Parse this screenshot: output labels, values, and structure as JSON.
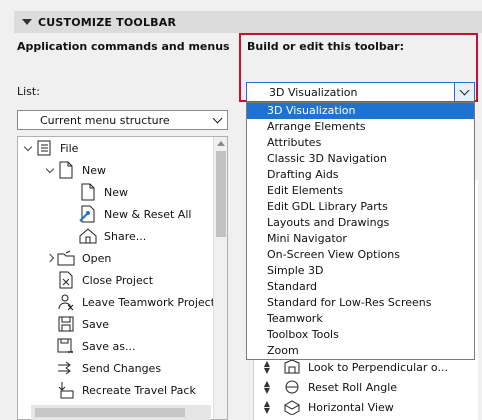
{
  "section": {
    "title": "CUSTOMIZE TOOLBAR"
  },
  "left": {
    "heading": "Application commands and menus",
    "list_label": "List:",
    "list_select": "Current menu structure",
    "tree": [
      {
        "label": "File",
        "indent": 0,
        "chevron": "down",
        "icon": "menu-list-icon"
      },
      {
        "label": "New",
        "indent": 1,
        "chevron": "down",
        "icon": "document-icon"
      },
      {
        "label": "New",
        "indent": 2,
        "chevron": "",
        "icon": "document-icon"
      },
      {
        "label": "New & Reset All",
        "indent": 2,
        "chevron": "",
        "icon": "new-reset-icon"
      },
      {
        "label": "Share...",
        "indent": 2,
        "chevron": "",
        "icon": "share-icon"
      },
      {
        "label": "Open",
        "indent": 1,
        "chevron": "right",
        "icon": "open-folder-icon"
      },
      {
        "label": "Close Project",
        "indent": 1,
        "chevron": "",
        "icon": "close-project-icon"
      },
      {
        "label": "Leave Teamwork Project",
        "indent": 1,
        "chevron": "",
        "icon": "leave-teamwork-icon"
      },
      {
        "label": "Save",
        "indent": 1,
        "chevron": "",
        "icon": "save-icon"
      },
      {
        "label": "Save as...",
        "indent": 1,
        "chevron": "",
        "icon": "save-as-icon"
      },
      {
        "label": "Send Changes",
        "indent": 1,
        "chevron": "",
        "icon": "send-changes-icon"
      },
      {
        "label": "Recreate Travel Pack",
        "indent": 1,
        "chevron": "",
        "icon": "travel-pack-icon"
      }
    ]
  },
  "right": {
    "heading": "Build or edit this toolbar:",
    "toolbar_select": "3D Visualization",
    "dropdown_options": [
      "3D Visualization",
      "Arrange Elements",
      "Attributes",
      "Classic 3D Navigation",
      "Drafting Aids",
      "Edit Elements",
      "Edit GDL Library Parts",
      "Layouts and Drawings",
      "Mini Navigator",
      "On-Screen View Options",
      "Simple 3D",
      "Standard",
      "Standard for Low-Res Screens",
      "Teamwork",
      "Toolbox Tools",
      "Zoom"
    ],
    "selected_index": 0,
    "toolbar_items": [
      {
        "label": "Look to Perpendicular o...",
        "icon": "perpendicular-icon"
      },
      {
        "label": "Reset Roll Angle",
        "icon": "roll-angle-icon"
      },
      {
        "label": "Horizontal View",
        "icon": "horizontal-view-icon"
      }
    ]
  },
  "colors": {
    "selection": "#1e73d2",
    "highlight_border": "#c8102e",
    "header_bg": "#dcdcdc"
  }
}
